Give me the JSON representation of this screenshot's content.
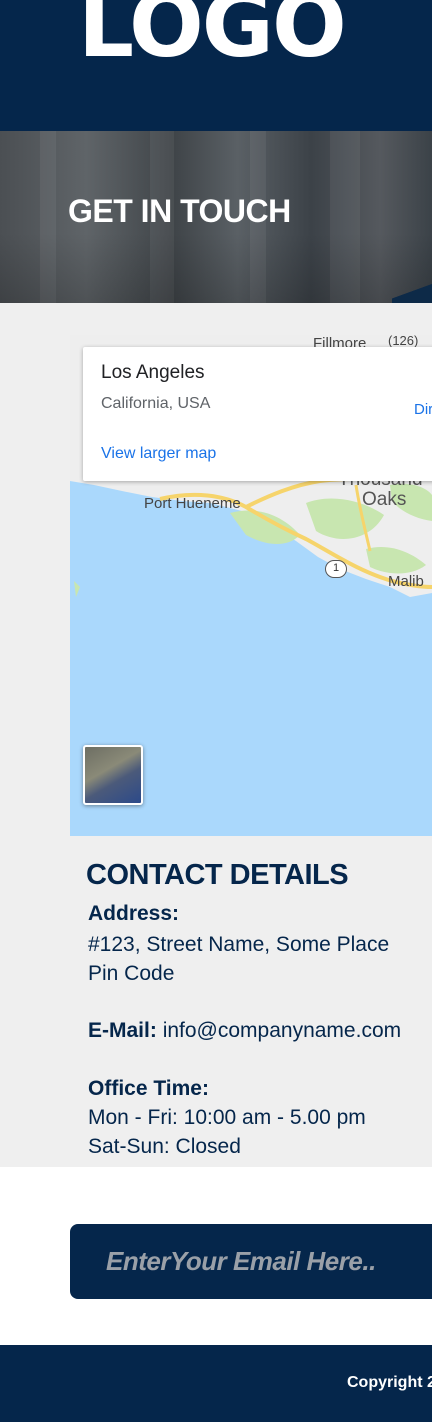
{
  "header": {
    "logo_text": "LOGO"
  },
  "hero": {
    "title": "GET IN TOUCH"
  },
  "map": {
    "place_title": "Los Angeles",
    "place_subtitle": "California, USA",
    "directions_label": "Dir",
    "view_larger_label": "View larger map",
    "labels": {
      "fillmore": "Fillmore",
      "route_126": "(126)",
      "thousand": "Thousand",
      "oaks": "Oaks",
      "port_hueneme": "Port Hueneme",
      "route_1": "1",
      "malibu": "Malib"
    },
    "colors": {
      "water": "#aad8fc",
      "land": "#eeeeee",
      "parks": "#c8e6b0",
      "highway": "#f6d46b"
    }
  },
  "contact": {
    "heading": "CONTACT DETAILS",
    "address_label": "Address:",
    "address_line1": "#123, Street Name, Some Place",
    "address_line2": "Pin Code",
    "email_label": "E-Mail:",
    "email_value": "info@companyname.com",
    "office_label": "Office Time:",
    "office_line1": "Mon - Fri: 10:00 am - 5.00 pm",
    "office_line2": "Sat-Sun: Closed"
  },
  "newsletter": {
    "placeholder": "EnterYour Email Here.."
  },
  "footer": {
    "copyright": "Copyright 2"
  },
  "colors": {
    "navy": "#05264b",
    "section_bg": "#efefef"
  }
}
